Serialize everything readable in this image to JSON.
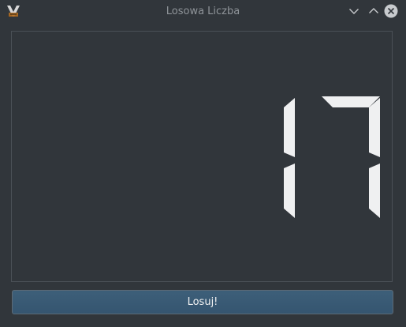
{
  "window": {
    "title": "Losowa Liczba"
  },
  "display": {
    "value": "17"
  },
  "button": {
    "label": "Losuj!"
  },
  "colors": {
    "background": "#31363b",
    "segment_on": "#eff0f1",
    "button_bg": "#3a5a74",
    "title_text": "#8f9499"
  },
  "icons": {
    "app": "app-icon",
    "minimize": "chevron-down-icon",
    "maximize": "chevron-up-icon",
    "close": "close-icon"
  }
}
